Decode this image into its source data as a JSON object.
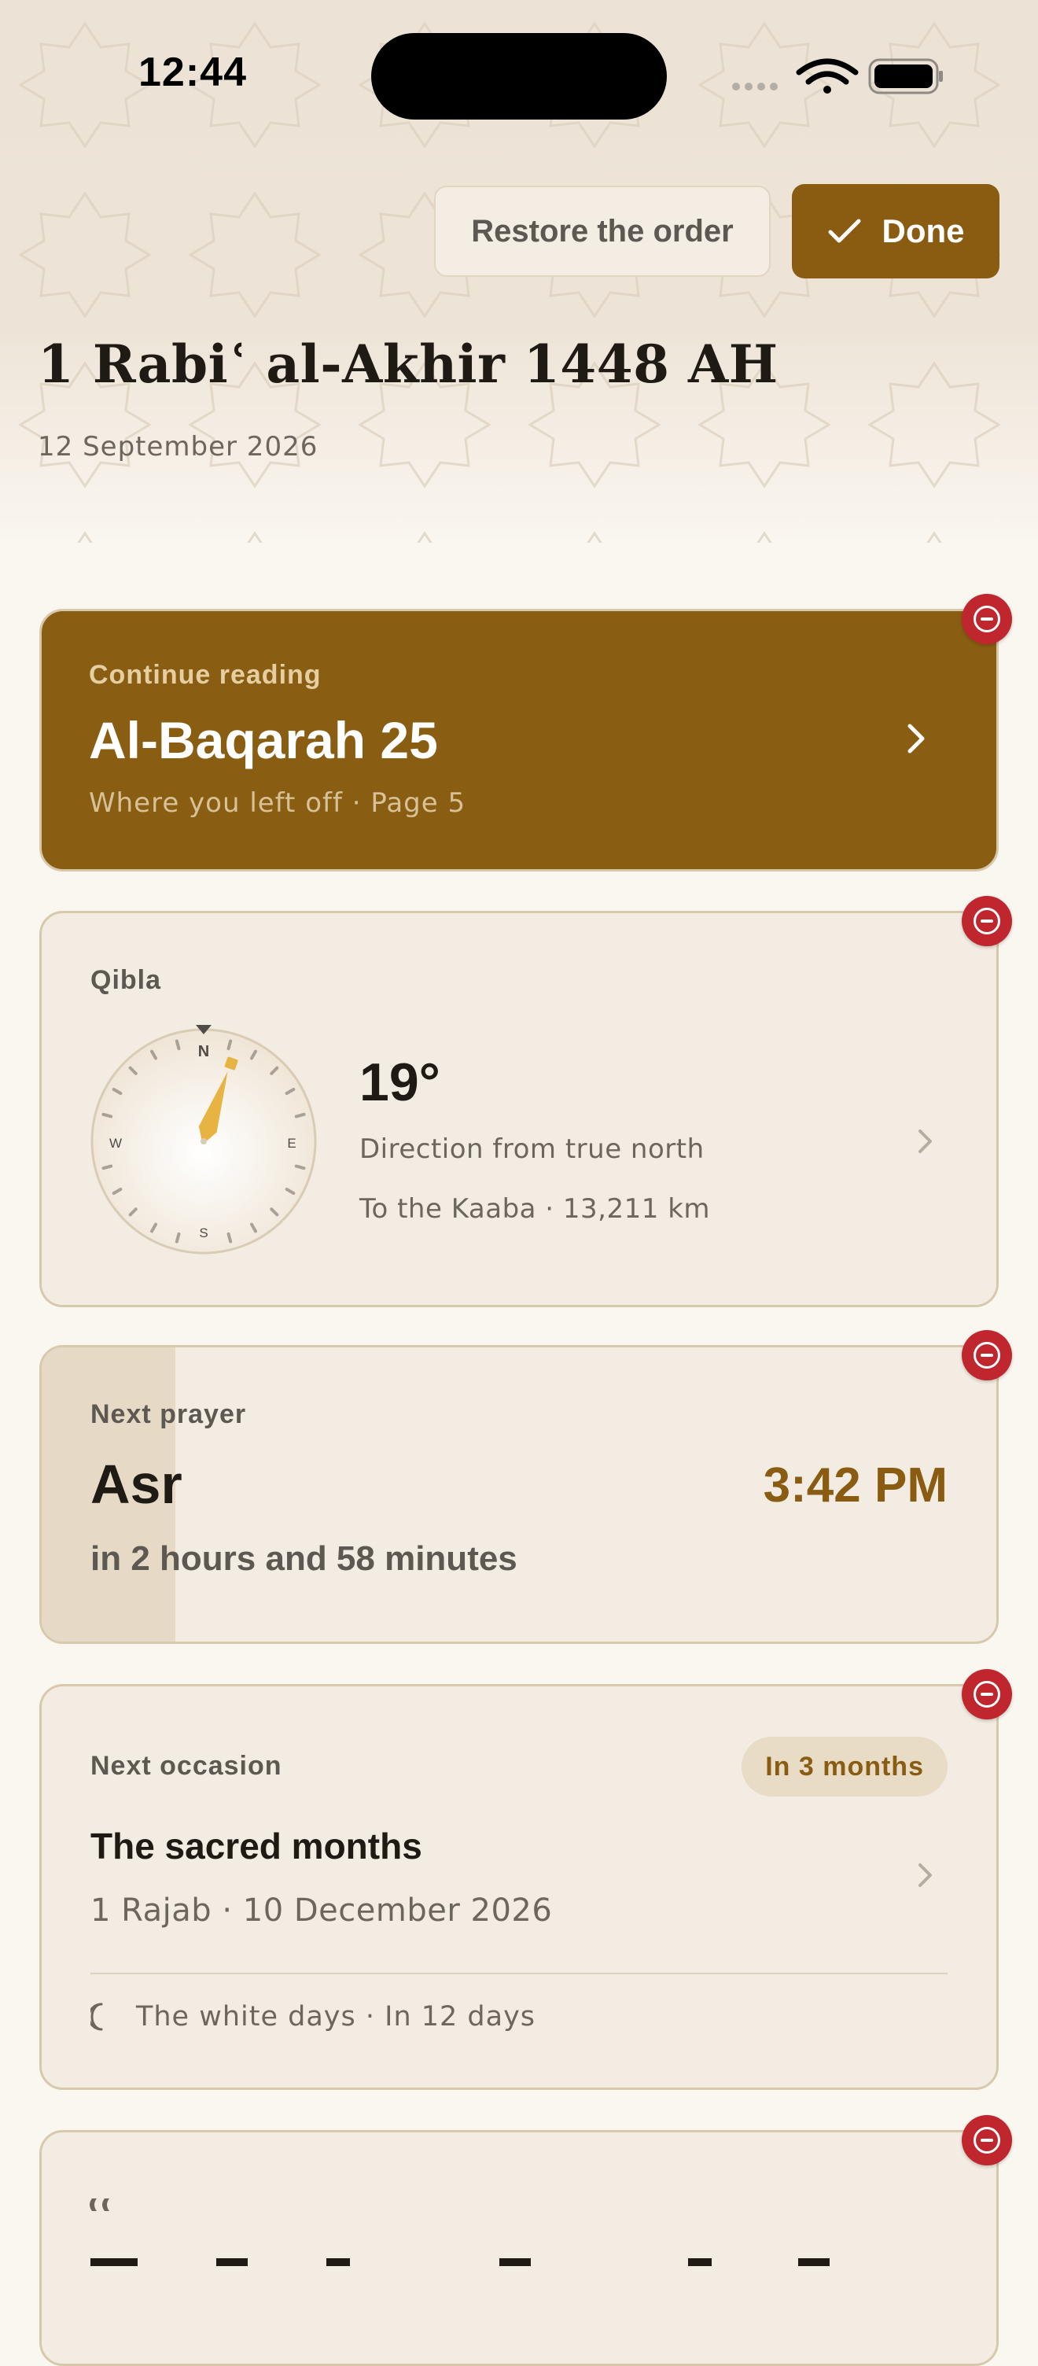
{
  "status_bar": {
    "time": "12:44"
  },
  "header": {
    "restore_label": "Restore the order",
    "done_label": "Done",
    "hijri_date": "1 Rabiʿ al-Akhir 1448 AH",
    "gregorian_date": "12 September 2026"
  },
  "cards": {
    "reading": {
      "eyebrow": "Continue reading",
      "title": "Al-Baqarah 25",
      "subtitle": "Where you left off · Page 5"
    },
    "qibla": {
      "label": "Qibla",
      "degrees": "19°",
      "description": "Direction from true north",
      "distance": "To the Kaaba · 13,211 km",
      "compass": {
        "n": "N",
        "e": "E",
        "s": "S",
        "w": "W",
        "heading_deg": 19
      }
    },
    "prayer": {
      "label": "Next prayer",
      "name": "Asr",
      "time": "3:42 PM",
      "countdown": "in 2 hours and 58 minutes",
      "progress_fraction": 0.14
    },
    "occasion": {
      "label": "Next occasion",
      "badge": "In 3 months",
      "title": "The sacred months",
      "date": "1 Rajab · 10 December 2026",
      "footer": "The white days · In 12 days"
    }
  },
  "colors": {
    "accent": "#8a5c12",
    "remove": "#c0262d",
    "gold": "#e7b443"
  }
}
